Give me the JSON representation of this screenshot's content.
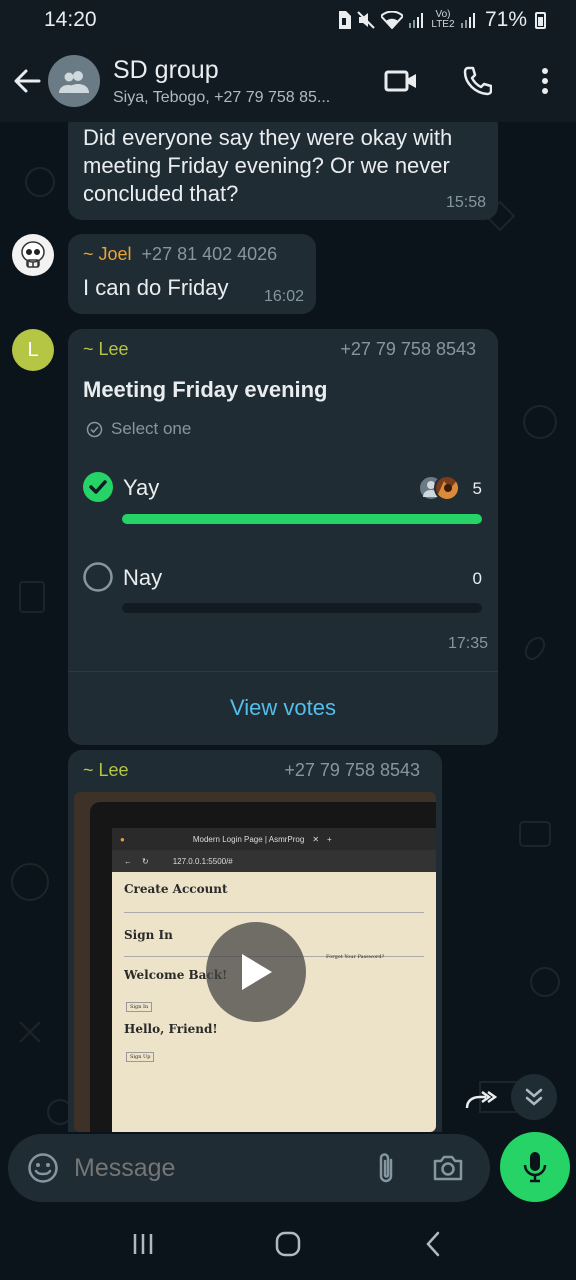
{
  "status_bar": {
    "time": "14:20",
    "network_label": "Vo) LTE2",
    "battery": "71%"
  },
  "header": {
    "title": "SD group",
    "subtitle": "Siya, Tebogo, +27 79 758 85..."
  },
  "messages": [
    {
      "text": "Did everyone say they were okay with meeting Friday evening? Or we never concluded that?",
      "time": "15:58"
    },
    {
      "sender_name": "~ Joel",
      "sender_color": "#e8a33a",
      "sender_phone": "+27 81 402 4026",
      "text": "I can do Friday",
      "time": "16:02"
    }
  ],
  "poll": {
    "sender_name": "~ Lee",
    "sender_color": "#b5c544",
    "avatar_letter": "L",
    "sender_phone": "+27 79 758 8543",
    "question": "Meeting Friday evening",
    "select_hint": "Select one",
    "options": [
      {
        "label": "Yay",
        "count": "5",
        "selected": true,
        "fill": 1.0
      },
      {
        "label": "Nay",
        "count": "0",
        "selected": false,
        "fill": 0.0
      }
    ],
    "time": "17:35",
    "view_votes": "View votes"
  },
  "video_message": {
    "sender_name": "~ Lee",
    "sender_phone": "+27 79 758 8543",
    "browser_tab": "Modern Login Page | AsmrProg",
    "browser_url": "127.0.0.1:5500/#",
    "page_headings": [
      "Create Account",
      "Sign In",
      "Welcome Back!",
      "Hello, Friend!"
    ],
    "forgot_link": "Forgot Your Password?",
    "sign_in_button": "Sign In",
    "sign_up_button": "Sign Up"
  },
  "composer": {
    "placeholder": "Message"
  },
  "colors": {
    "accent": "#25d366",
    "bubble": "#202c33",
    "background": "#0b141a",
    "link": "#53bdeb"
  }
}
